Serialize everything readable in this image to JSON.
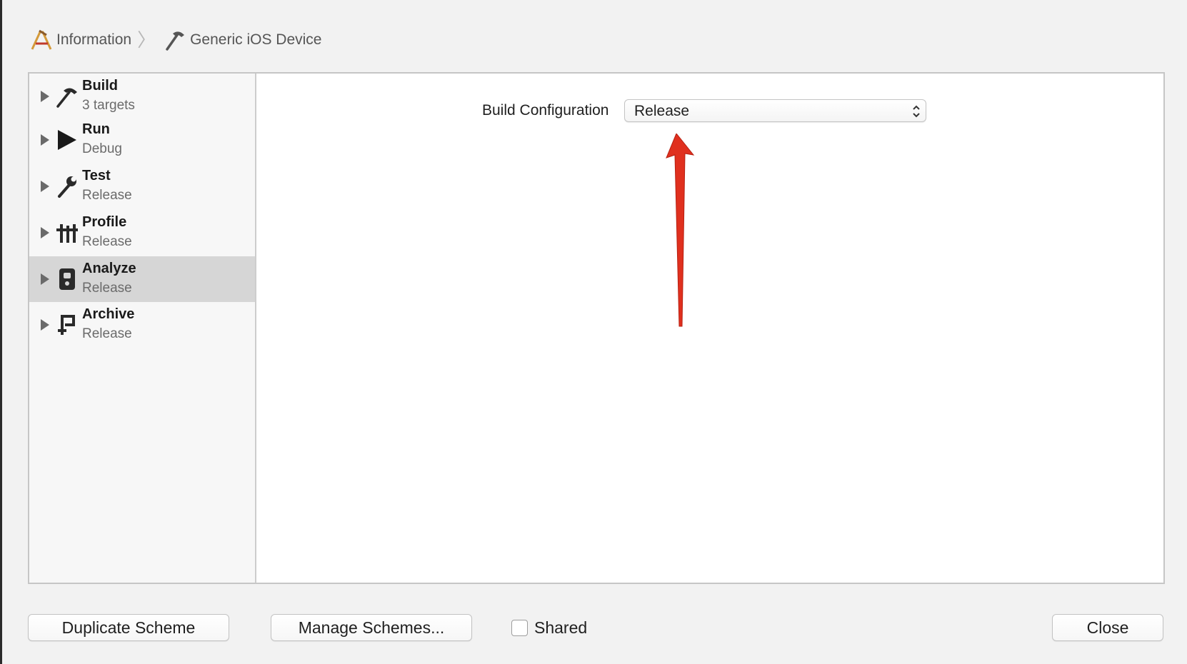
{
  "breadcrumb": {
    "items": [
      {
        "label": "Information",
        "icon": "app-icon"
      },
      {
        "label": "Generic iOS Device",
        "icon": "hammer-icon"
      }
    ]
  },
  "sidebar": {
    "items": [
      {
        "title": "Build",
        "subtitle": "3 targets",
        "icon": "hammer-icon",
        "selected": false
      },
      {
        "title": "Run",
        "subtitle": "Debug",
        "icon": "play-icon",
        "selected": false
      },
      {
        "title": "Test",
        "subtitle": "Release",
        "icon": "wrench-icon",
        "selected": false
      },
      {
        "title": "Profile",
        "subtitle": "Release",
        "icon": "gauge-icon",
        "selected": false
      },
      {
        "title": "Analyze",
        "subtitle": "Release",
        "icon": "analyze-icon",
        "selected": true
      },
      {
        "title": "Archive",
        "subtitle": "Release",
        "icon": "archive-icon",
        "selected": false
      }
    ]
  },
  "content": {
    "config_label": "Build Configuration",
    "config_value": "Release"
  },
  "footer": {
    "duplicate_label": "Duplicate Scheme",
    "manage_label": "Manage Schemes...",
    "shared_label": "Shared",
    "shared_checked": false,
    "close_label": "Close"
  },
  "colors": {
    "annotation_arrow": "#e0301e",
    "selected_row": "#d6d6d6"
  }
}
